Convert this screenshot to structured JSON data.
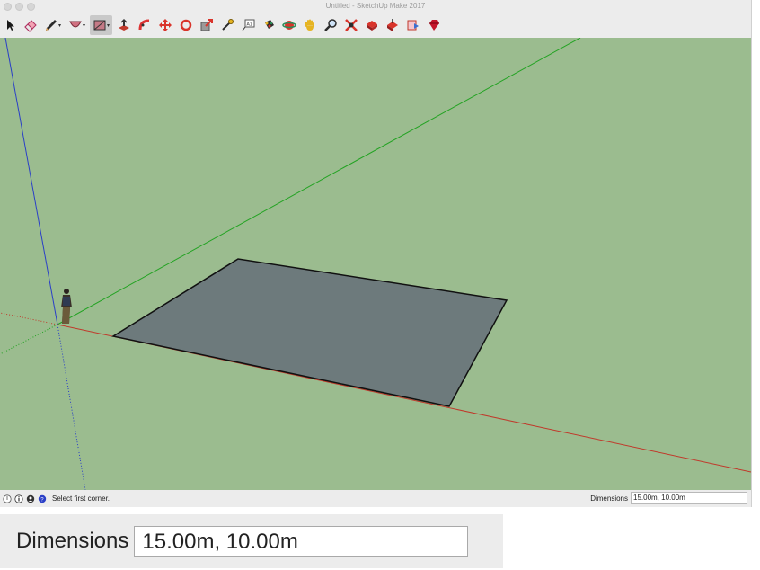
{
  "window": {
    "title": "Untitled - SketchUp Make 2017"
  },
  "toolbar": {
    "tools": [
      {
        "name": "select-tool",
        "icon": "arrow-cursor-icon"
      },
      {
        "name": "eraser-tool",
        "icon": "eraser-icon"
      },
      {
        "name": "line-tool",
        "icon": "pencil-icon"
      },
      {
        "name": "arc-tool",
        "icon": "arc-icon"
      },
      {
        "name": "rectangle-tool",
        "icon": "rectangle-icon"
      },
      {
        "name": "push-pull-tool",
        "icon": "push-pull-icon"
      },
      {
        "name": "follow-me-tool",
        "icon": "follow-me-icon"
      },
      {
        "name": "move-tool",
        "icon": "move-icon"
      },
      {
        "name": "rotate-tool",
        "icon": "rotate-icon"
      },
      {
        "name": "scale-tool",
        "icon": "scale-icon"
      },
      {
        "name": "tape-measure-tool",
        "icon": "tape-measure-icon"
      },
      {
        "name": "text-tool",
        "icon": "text-icon"
      },
      {
        "name": "paint-bucket-tool",
        "icon": "paint-bucket-icon"
      },
      {
        "name": "orbit-tool",
        "icon": "orbit-icon"
      },
      {
        "name": "pan-tool",
        "icon": "pan-hand-icon"
      },
      {
        "name": "zoom-tool",
        "icon": "magnifier-icon"
      },
      {
        "name": "zoom-extents-tool",
        "icon": "zoom-extents-icon"
      },
      {
        "name": "3d-warehouse-tool",
        "icon": "warehouse-icon"
      },
      {
        "name": "share-model-tool",
        "icon": "share-model-icon"
      },
      {
        "name": "extension-warehouse-tool",
        "icon": "extension-icon"
      },
      {
        "name": "layout-send-tool",
        "icon": "layout-icon"
      },
      {
        "name": "ruby-tool",
        "icon": "ruby-icon"
      }
    ],
    "active_tool": "rectangle-tool"
  },
  "status": {
    "icons": [
      "geo-location-icon",
      "info-icon",
      "credits-icon",
      "instructor-icon"
    ],
    "message": "Select first corner.",
    "dimensions_label": "Dimensions",
    "dimensions_value": "15.00m, 10.00m"
  },
  "zoom_inset": {
    "label": "Dimensions",
    "value": "15.00m, 10.00m"
  },
  "colors": {
    "viewport_bg": "#9bbc8f",
    "face": "#6d7a7c",
    "red_axis": "#c0392b",
    "green_axis": "#23a323",
    "blue_axis": "#2a3fc7"
  }
}
